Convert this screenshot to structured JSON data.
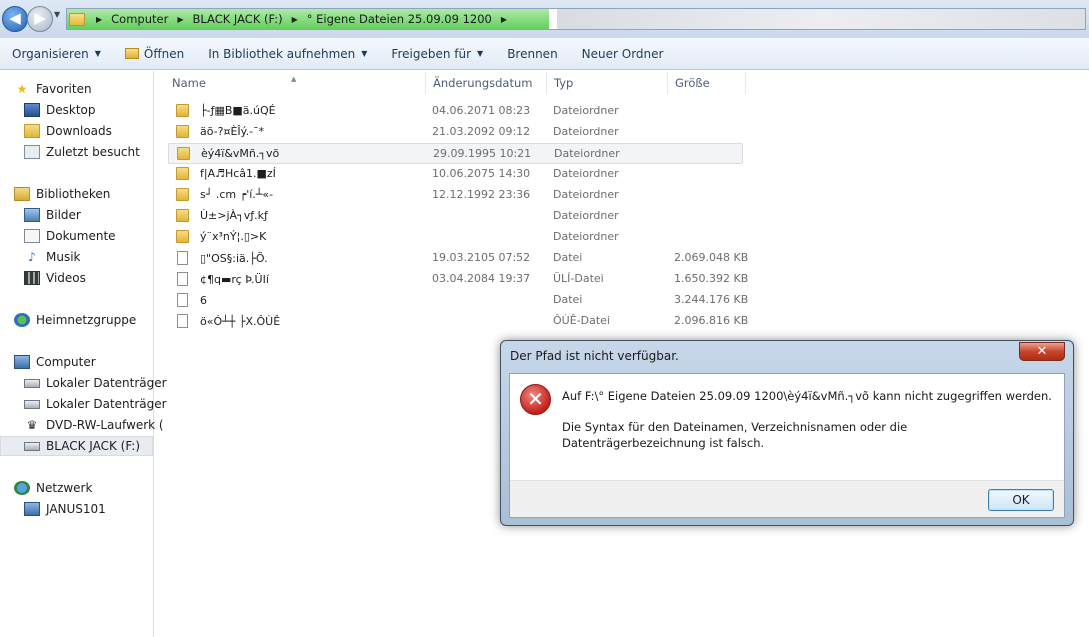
{
  "breadcrumb": {
    "items": [
      "Computer",
      "BLACK JACK (F:)",
      "° Eigene Dateien 25.09.09 1200"
    ]
  },
  "toolbar": {
    "organize": "Organisieren",
    "open": "Öffnen",
    "add_library": "In Bibliothek aufnehmen",
    "share": "Freigeben für",
    "burn": "Brennen",
    "new_folder": "Neuer Ordner"
  },
  "nav": {
    "favorites": "Favoriten",
    "desktop": "Desktop",
    "downloads": "Downloads",
    "recent": "Zuletzt besucht",
    "libraries": "Bibliotheken",
    "pictures": "Bilder",
    "documents": "Dokumente",
    "music": "Musik",
    "videos": "Videos",
    "homegroup": "Heimnetzgruppe",
    "computer": "Computer",
    "local1": "Lokaler Datenträger",
    "local2": "Lokaler Datenträger",
    "dvd": "DVD-RW-Laufwerk (",
    "blackjack": "BLACK JACK (F:)",
    "network": "Netzwerk",
    "janus": "JANUS101"
  },
  "columns": {
    "name": "Name",
    "date": "Änderungsdatum",
    "type": "Typ",
    "size": "Größe"
  },
  "files": [
    {
      "name": "├-ƒ▦B■ä.úQÉ",
      "date": "04.06.2071 08:23",
      "type": "Dateiordner",
      "size": ""
    },
    {
      "name": "äõ-?¤ÈÎý.-¯*",
      "date": "21.03.2092 09:12",
      "type": "Dateiordner",
      "size": ""
    },
    {
      "name": "èý4ï&vMñ.┐võ",
      "date": "29.09.1995 10:21",
      "type": "Dateiordner",
      "size": ""
    },
    {
      "name": "f|A♬Hcâ1.■zÍ",
      "date": "10.06.2075 14:30",
      "type": "Dateiordner",
      "size": ""
    },
    {
      "name": "s┘ .cm ┍'í.┴«-",
      "date": "12.12.1992 23:36",
      "type": "Dateiordner",
      "size": ""
    },
    {
      "name": "Ù±>jÀ┐vƒ.kƒ",
      "date": "",
      "type": "Dateiordner",
      "size": ""
    },
    {
      "name": "ý¨x³nÝ¦.▯>K",
      "date": "",
      "type": "Dateiordner",
      "size": ""
    },
    {
      "name": "▯\"OS§:iä.├Õ.",
      "date": "19.03.2105 07:52",
      "type": "Datei",
      "size": "2.069.048 KB"
    },
    {
      "name": "¢¶q▬rç Þ.ÜIí",
      "date": "03.04.2084 19:37",
      "type": "ÜLÍ-Datei",
      "size": "1.650.392 KB"
    },
    {
      "name": "6",
      "date": "",
      "type": "Datei",
      "size": "3.244.176 KB"
    },
    {
      "name": "ö«Ó┴┼ ├X.ÔÙÊ",
      "date": "",
      "type": "ÔÙÊ-Datei",
      "size": "2.096.816 KB"
    }
  ],
  "dialog": {
    "title": "Der Pfad ist nicht verfügbar.",
    "close": "✕",
    "message1": "Auf F:\\° Eigene Dateien 25.09.09 1200\\èý4ï&vMñ.┐võ kann nicht zugegriffen werden.",
    "message2": "Die Syntax für den Dateinamen, Verzeichnisnamen oder die Datenträgerbezeichnung ist falsch.",
    "ok": "OK"
  }
}
